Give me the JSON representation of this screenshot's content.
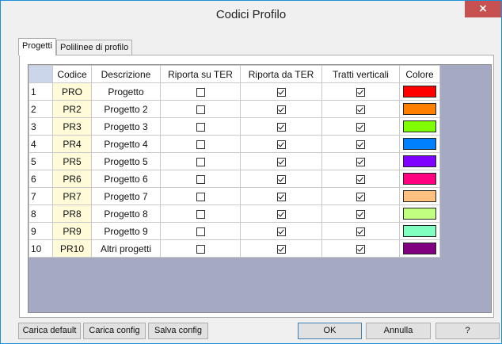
{
  "window": {
    "title": "Codici Profilo",
    "close_label": "×"
  },
  "tabs": [
    {
      "label": "Progetti",
      "active": true
    },
    {
      "label": "Polilinee di profilo",
      "active": false
    }
  ],
  "grid": {
    "columns": [
      "Codice",
      "Descrizione",
      "Riporta su TER",
      "Riporta da TER",
      "Tratti verticali",
      "Colore"
    ],
    "rows": [
      {
        "num": "1",
        "codice": "PRO",
        "descrizione": "Progetto",
        "riporta_su_ter": false,
        "riporta_da_ter": true,
        "tratti_verticali": true,
        "colore": "#ff0000"
      },
      {
        "num": "2",
        "codice": "PR2",
        "descrizione": "Progetto 2",
        "riporta_su_ter": false,
        "riporta_da_ter": true,
        "tratti_verticali": true,
        "colore": "#ff8000"
      },
      {
        "num": "3",
        "codice": "PR3",
        "descrizione": "Progetto 3",
        "riporta_su_ter": false,
        "riporta_da_ter": true,
        "tratti_verticali": true,
        "colore": "#80ff00"
      },
      {
        "num": "4",
        "codice": "PR4",
        "descrizione": "Progetto 4",
        "riporta_su_ter": false,
        "riporta_da_ter": true,
        "tratti_verticali": true,
        "colore": "#0080ff"
      },
      {
        "num": "5",
        "codice": "PR5",
        "descrizione": "Progetto 5",
        "riporta_su_ter": false,
        "riporta_da_ter": true,
        "tratti_verticali": true,
        "colore": "#8000ff"
      },
      {
        "num": "6",
        "codice": "PR6",
        "descrizione": "Progetto 6",
        "riporta_su_ter": false,
        "riporta_da_ter": true,
        "tratti_verticali": true,
        "colore": "#ff0080"
      },
      {
        "num": "7",
        "codice": "PR7",
        "descrizione": "Progetto 7",
        "riporta_su_ter": false,
        "riporta_da_ter": true,
        "tratti_verticali": true,
        "colore": "#ffc080"
      },
      {
        "num": "8",
        "codice": "PR8",
        "descrizione": "Progetto 8",
        "riporta_su_ter": false,
        "riporta_da_ter": true,
        "tratti_verticali": true,
        "colore": "#c0ff80"
      },
      {
        "num": "9",
        "codice": "PR9",
        "descrizione": "Progetto 9",
        "riporta_su_ter": false,
        "riporta_da_ter": true,
        "tratti_verticali": true,
        "colore": "#80ffc0"
      },
      {
        "num": "10",
        "codice": "PR10",
        "descrizione": "Altri progetti",
        "riporta_su_ter": false,
        "riporta_da_ter": true,
        "tratti_verticali": true,
        "colore": "#800080"
      }
    ]
  },
  "buttons": {
    "carica_default": "Carica default",
    "carica_config": "Carica config",
    "salva_config": "Salva config",
    "ok": "OK",
    "annulla": "Annulla",
    "help": "?"
  },
  "colors": {
    "accent": "#1e90d8",
    "close_button": "#c75050",
    "grid_background": "#a6a9c2",
    "code_cell": "#fffbd9"
  }
}
